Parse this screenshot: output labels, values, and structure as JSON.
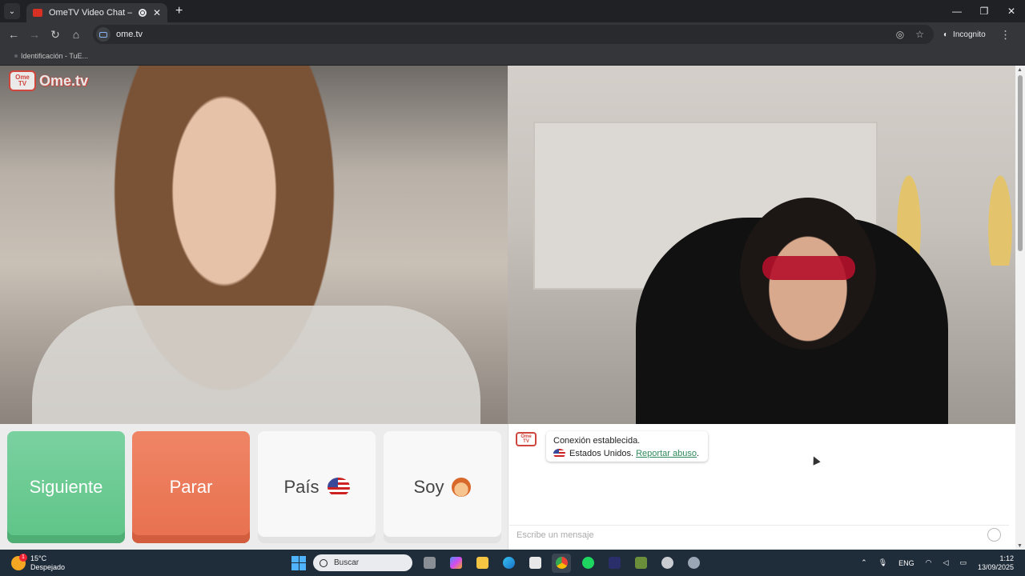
{
  "browser": {
    "tab_title": "OmeTV Video Chat — Ome",
    "tab_close": "✕",
    "new_tab": "+",
    "url": "ome.tv",
    "incognito_label": "Incognito",
    "bookmark": "Identificación - TuE...",
    "window_controls": {
      "minimize": "—",
      "maximize": "❐",
      "close": "✕"
    }
  },
  "site": {
    "logo_badge": "Ome TV",
    "logo_text": "Ome.tv"
  },
  "controls": {
    "next": "Siguiente",
    "stop": "Parar",
    "country": "País",
    "gender": "Soy"
  },
  "chat": {
    "logo_badge": "Ome TV",
    "message_line1": "Conexión establecida.",
    "country_name": "Estados Unidos.",
    "report_link": "Reportar abuso",
    "report_suffix": ".",
    "input_placeholder": "Escribe un mensaje"
  },
  "taskbar": {
    "weather_badge": "1",
    "temperature": "15°C",
    "weather_desc": "Despejado",
    "search_placeholder": "Buscar",
    "language": "ENG",
    "time": "1:12",
    "date": "13/09/2025"
  },
  "colors": {
    "next_button": "#6ccb93",
    "stop_button": "#ea7a58",
    "report_link": "#2f8a5c",
    "brand": "#d0453c"
  }
}
